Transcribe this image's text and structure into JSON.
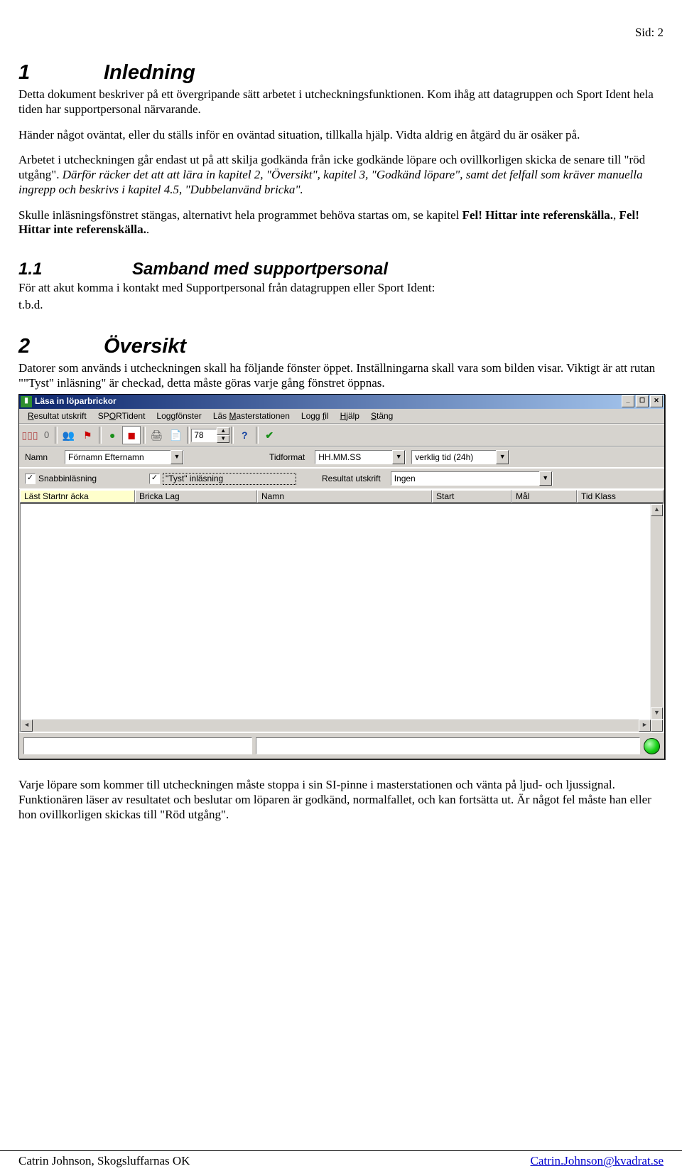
{
  "page": {
    "pagenum": "Sid: 2"
  },
  "h1a": {
    "num": "1",
    "title": "Inledning"
  },
  "p1": "Detta dokument beskriver på ett övergripande sätt arbetet i utcheckningsfunktionen. Kom ihåg att datagruppen och Sport Ident hela tiden har supportpersonal närvarande.",
  "p2": "Händer något oväntat, eller du ställs inför en oväntad situation, tillkalla hjälp. Vidta aldrig en åtgärd du är osäker på.",
  "p3a": "Arbetet i utcheckningen går endast ut på att skilja godkända från icke godkände löpare och ovillkorligen skicka de senare till \"röd utgång\". ",
  "p3b": "Därför räcker det att att lära in kapitel 2, \"Översikt\", kapitel 3, \"Godkänd löpare\", samt det felfall som kräver manuella ingrepp och beskrivs i kapitel 4.5, \"Dubbelanvänd bricka\".",
  "p4a": "Skulle inläsningsfönstret stängas, alternativt hela programmet behöva startas om, se kapitel ",
  "p4b": "Fel! Hittar inte referenskälla.",
  "p4c": ", ",
  "p4d": "Fel! Hittar inte referenskälla.",
  "p4e": ".",
  "h2a": {
    "num": "1.1",
    "title": "Samband med supportpersonal"
  },
  "p5": "För att akut komma i kontakt med Supportpersonal från datagruppen eller Sport Ident:",
  "p6": "t.b.d.",
  "h1b": {
    "num": "2",
    "title": "Översikt"
  },
  "p7": "Datorer som används i utcheckningen skall ha följande fönster öppet. Inställningarna skall vara som bilden visar. Viktigt är att rutan \"\"Tyst\" inläsning\" är checkad, detta måste göras varje gång fönstret öppnas.",
  "p8": "Varje löpare som kommer till utcheckningen måste stoppa i sin SI-pinne i masterstationen och vänta på ljud- och ljussignal. Funktionären läser av resultatet och beslutar om löparen är godkänd, normalfallet, och kan fortsätta ut. Är något fel måste han eller hon ovillkorligen skickas till \"Röd utgång\".",
  "win": {
    "title": "Läsa in löparbrickor",
    "menu": {
      "m1": "Resultat utskrift",
      "m2": "SPORTident",
      "m3": "Loggfönster",
      "m4": "Läs Masterstationen",
      "m5": "Logg fil",
      "m6": "Hjälp",
      "m7": "Stäng"
    },
    "toolbar": {
      "counter": "0",
      "spin_value": "78"
    },
    "row1": {
      "namn_label": "Namn",
      "namn_value": "Förnamn Efternamn",
      "tid_label": "Tidformat",
      "tid_value": "HH.MM.SS",
      "verk_value": "verklig tid (24h)"
    },
    "row2": {
      "snabb_label": "Snabbinläsning",
      "tyst_label": "\"Tyst\" inläsning",
      "res_label": "Resultat utskrift",
      "res_value": "Ingen"
    },
    "headers": {
      "c1": "Läst  Startnr  äcka",
      "c2": "Bricka  Lag",
      "c3": "Namn",
      "c4": "Start",
      "c5": "Mål",
      "c6": "Tid  Klass"
    }
  },
  "footer": {
    "left": "Catrin Johnson, Skogsluffarnas OK",
    "right": "Catrin.Johnson@kvadrat.se"
  }
}
